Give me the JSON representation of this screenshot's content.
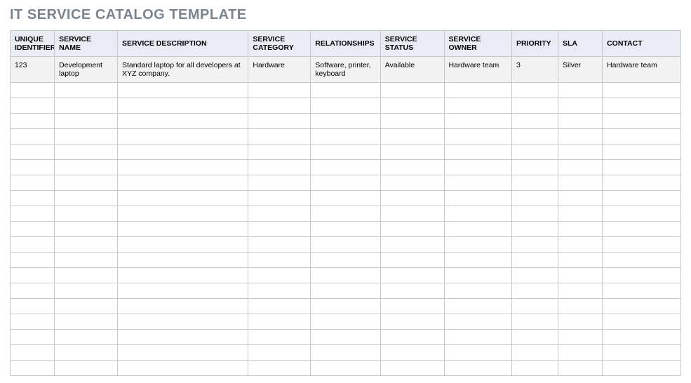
{
  "title": "IT SERVICE CATALOG TEMPLATE",
  "headers": {
    "id": "UNIQUE IDENTIFIER",
    "name": "SERVICE NAME",
    "desc": "SERVICE DESCRIPTION",
    "cat": "SERVICE CATEGORY",
    "rel": "RELATIONSHIPS",
    "status": "SERVICE STATUS",
    "owner": "SERVICE OWNER",
    "prio": "PRIORITY",
    "sla": "SLA",
    "contact": "CONTACT"
  },
  "rows": [
    {
      "id": "123",
      "name": "Development laptop",
      "desc": "Standard laptop for all developers at XYZ company.",
      "cat": "Hardware",
      "rel": "Software, printer, keyboard",
      "status": "Available",
      "owner": "Hardware team",
      "prio": "3",
      "sla": "Silver",
      "contact": "Hardware team"
    }
  ],
  "empty_row_count": 19
}
